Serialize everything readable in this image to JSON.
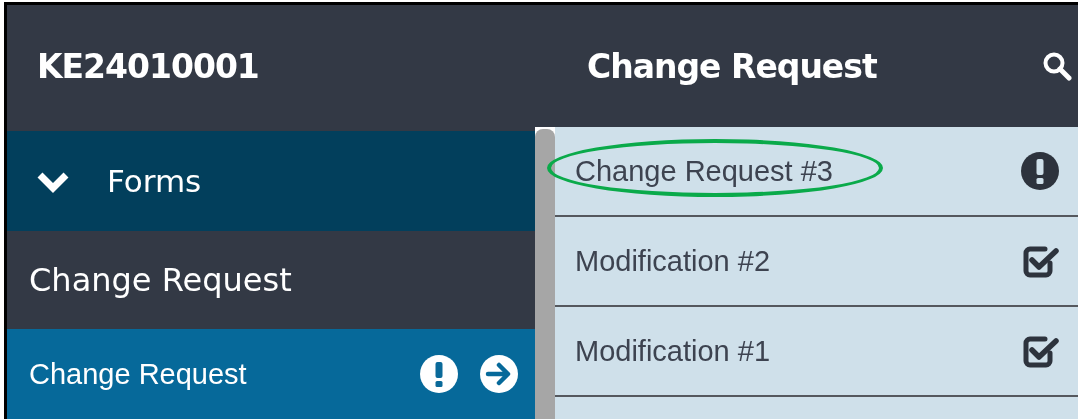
{
  "header": {
    "record_id": "KE24010001",
    "title": "Change Request"
  },
  "sidebar": {
    "section": {
      "label": "Forms",
      "expanded": true
    },
    "group_title": "Change Request",
    "items": [
      {
        "label": "Change Request",
        "selected": true,
        "alert": true,
        "open_button": true
      }
    ]
  },
  "list": {
    "items": [
      {
        "label": "Change Request #3",
        "kind": "alert",
        "highlighted": true
      },
      {
        "label": "Modification #2",
        "kind": "done",
        "highlighted": false
      },
      {
        "label": "Modification #1",
        "kind": "done",
        "highlighted": false
      }
    ]
  }
}
